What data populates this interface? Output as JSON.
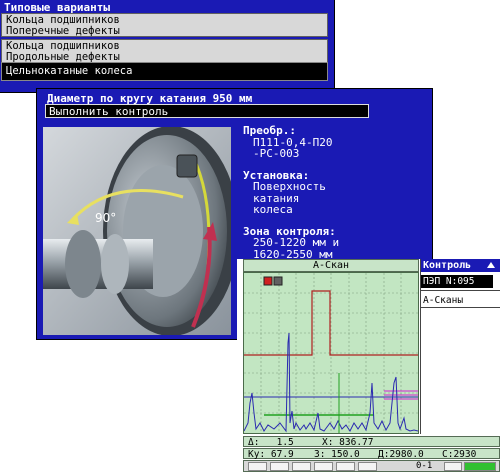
{
  "back_window": {
    "title": "Типовые варианты",
    "items": [
      {
        "line1": "Кольца подшипников",
        "line2": "Поперечные дефекты"
      },
      {
        "line1": "Кольца подшипников",
        "line2": "Продольные дефекты"
      },
      {
        "line1": "Цельнокатаные колеса",
        "line2": ""
      }
    ]
  },
  "front_window": {
    "title": "Диаметр по кругу катания 950 мм",
    "run_button": "Выполнить контроль",
    "photo_angle": "90°",
    "converter_label": "Преобр.:",
    "converter_value_1": "П111-0,4-П20",
    "converter_value_2": "-PC-003",
    "mount_label": "Установка:",
    "mount_value_1": "Поверхность",
    "mount_value_2": "катания",
    "mount_value_3": "колеса",
    "zone_label": "Зона контроля:",
    "zone_value_1": "250-1220 мм и",
    "zone_value_2": "1620-2550 мм"
  },
  "scope": {
    "title": "А-Скан",
    "side_title": "Контроль",
    "probe": "ПЭП N:095",
    "ascans": "А-Сканы",
    "status1": {
      "delta": "Δ:   1.5",
      "x": "X: 836.77"
    },
    "status2": {
      "ku": "Ку: 67.9",
      "z": "З: 150.0",
      "d": "Д:2980.0",
      "c": "С:2930"
    },
    "zero_one": "0-1",
    "colors": {
      "screen": "#c2e6c2",
      "signal": "#2a2ab0",
      "gate_red": "#b02020",
      "gate_green": "#20a020",
      "gate_magenta": "#d020d0"
    }
  }
}
